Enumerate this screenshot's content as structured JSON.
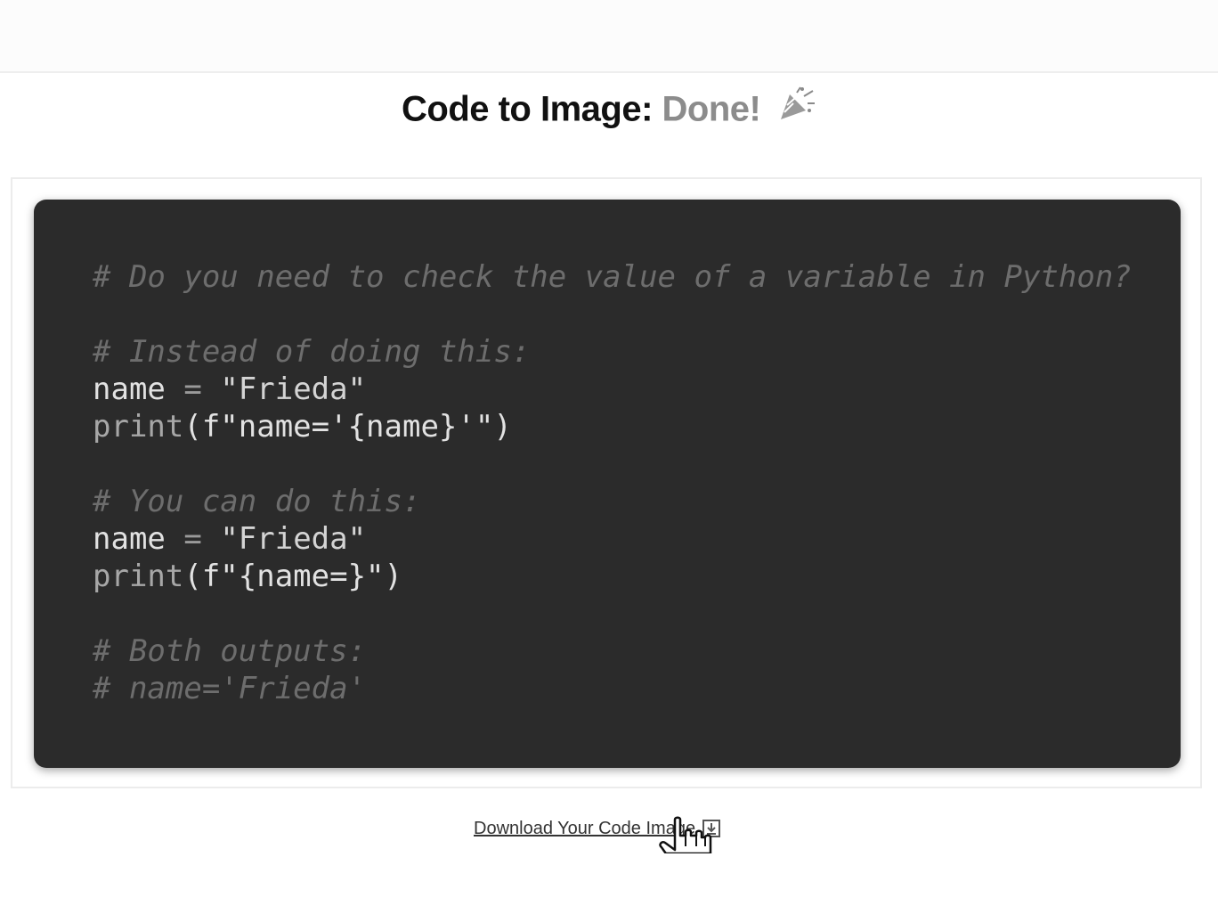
{
  "header": {
    "title": "Code to Image:",
    "status": "Done!",
    "celebration_icon": "party-popper-icon"
  },
  "code": {
    "comment1": "# Do you need to check the value of a variable in Python?",
    "comment2": "# Instead of doing this:",
    "line3_a": "name",
    "line3_op": " = ",
    "line3_b": "\"Frieda\"",
    "line4_fn": "print",
    "line4_a": "(f\"name='{name}'\")",
    "comment5": "# You can do this:",
    "line6_a": "name",
    "line6_op": " = ",
    "line6_b": "\"Frieda\"",
    "line7_fn": "print",
    "line7_a": "(f\"{name=}\")",
    "comment8": "# Both outputs:",
    "comment9": "# name='Frieda'"
  },
  "download": {
    "link_label": "Download Your Code Image",
    "icon": "download-icon"
  },
  "colors": {
    "card_background": "#2b2b2b",
    "comment": "#6d6d6d",
    "code_text": "#e2e2e2",
    "title_status": "#8c8c8c"
  }
}
